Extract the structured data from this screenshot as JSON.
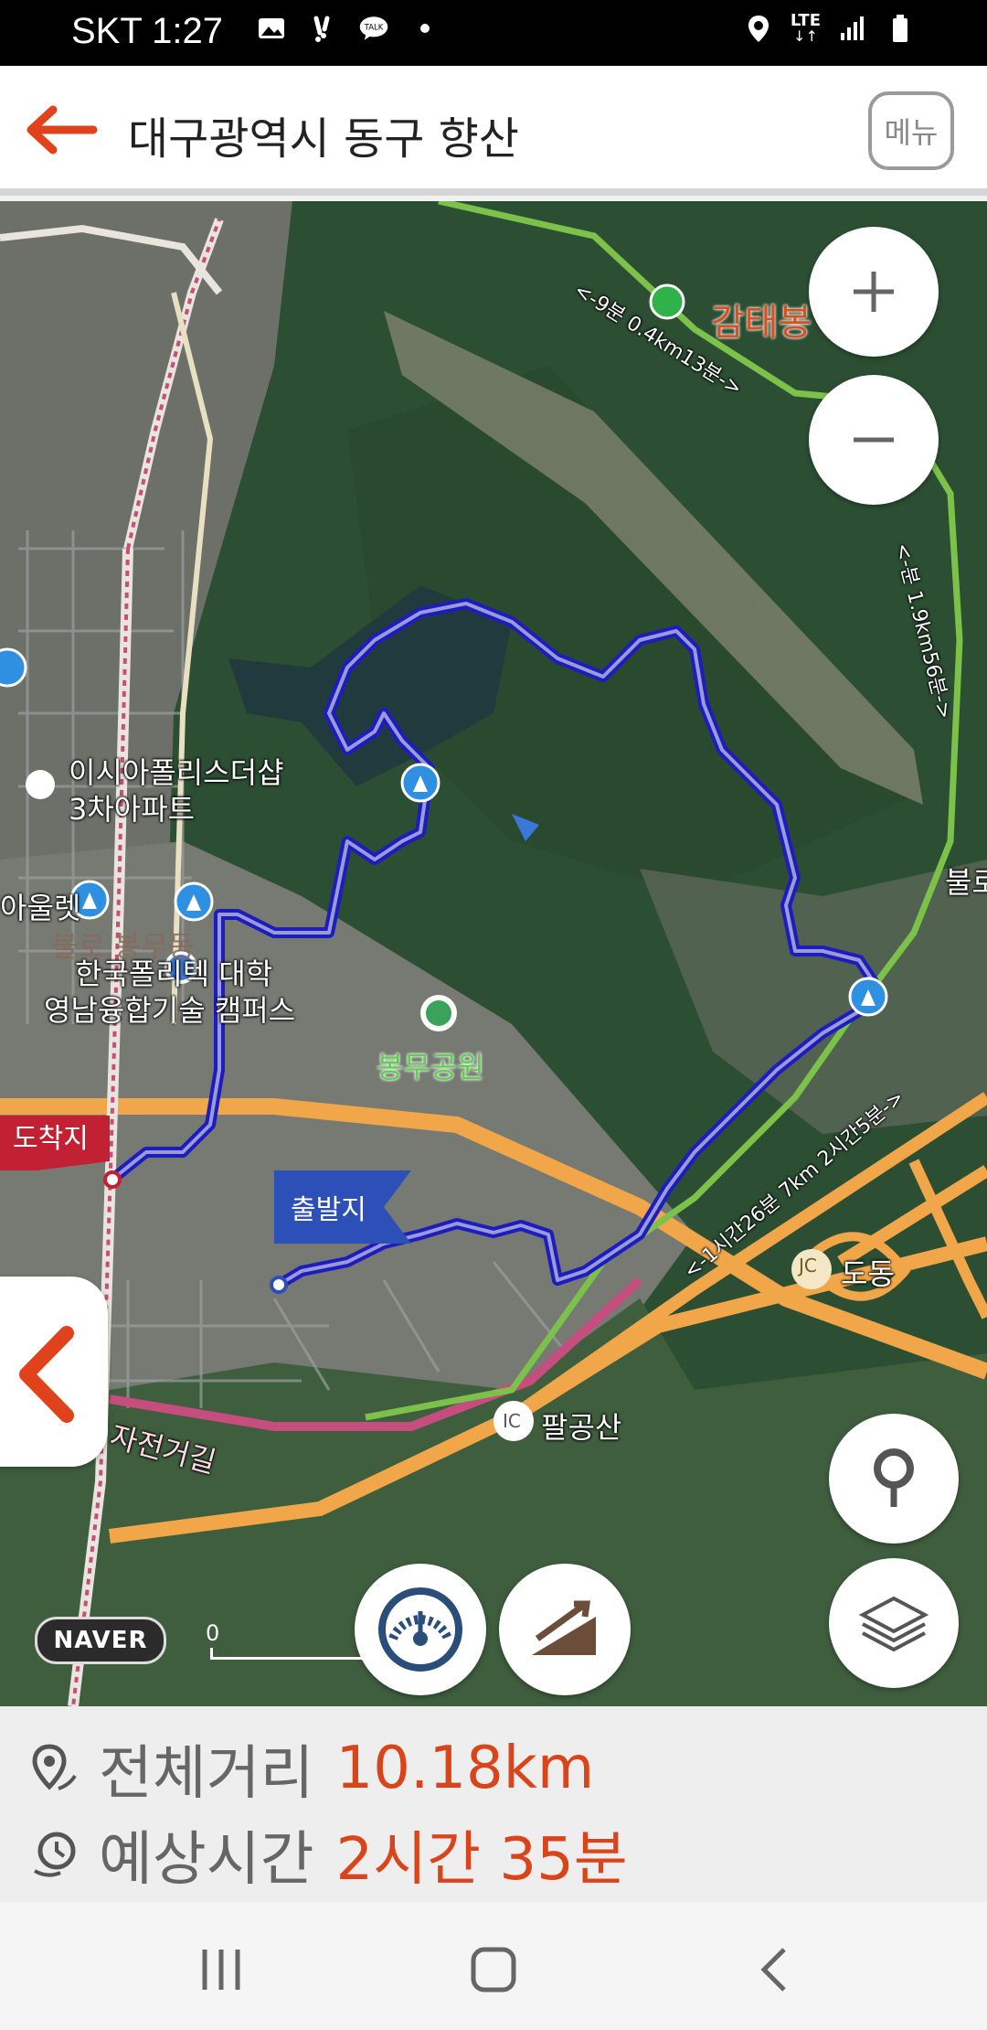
{
  "status_bar": {
    "time": "SKT 1:27",
    "lte": "LTE",
    "left_icons": [
      "image-icon",
      "notification-icon",
      "talk-icon",
      "dot-icon"
    ],
    "right_icons": [
      "location-icon",
      "lte-icon",
      "signal-icon",
      "battery-icon"
    ]
  },
  "header": {
    "title": "대구광역시 동구 향산",
    "menu_label": "메뉴",
    "accent": "#e0421b"
  },
  "map": {
    "labels": {
      "isia": "이시아폴리스더샵",
      "isia2": "3차아파트",
      "outlet": "아울렛",
      "college1": "한국폴리텍 대학",
      "college2": "영남융합기술 캠퍼스",
      "park": "봉무공원",
      "gamtae": "감태봉",
      "dodong": "도동",
      "palgongsan": "팔공산",
      "bikeway": "자전거길",
      "boro": "불로.봉무동",
      "boro2": "불로",
      "trail_top": "<-9분 0.4km13분->",
      "trail_right": "<-분 1.9km56분->",
      "trail_mid": "<-1시간26분 7km 2시간5분->",
      "jc": "JC",
      "ic": "IC"
    },
    "start_flag": "출발지",
    "end_flag": "도착지",
    "naver": "NAVER",
    "scale_zero": "0",
    "route_color": "#2b2bd6",
    "highway_color": "#f2a64a",
    "trail_color": "#7cc24a"
  },
  "info": {
    "distance_label": "전체거리",
    "distance_value": "10.18km",
    "time_label": "예상시간",
    "time_value": "2시간 35분",
    "value_color": "#d9441a"
  }
}
